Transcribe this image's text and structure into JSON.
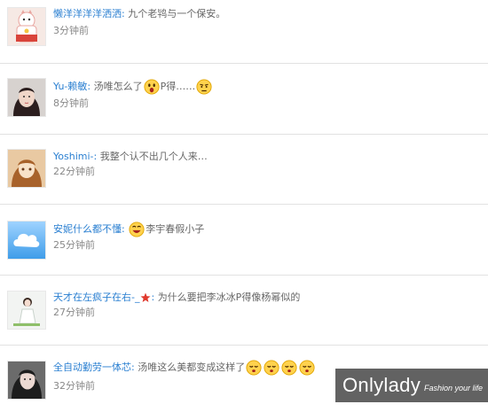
{
  "feed": {
    "items": [
      {
        "user": "懒洋洋洋洋洒洒",
        "text": "九个老鸨与一个保安。",
        "time": "3分钟前",
        "avatar": "lucky-cat-avatar"
      },
      {
        "user": "Yu-赖敏",
        "text": "汤唯怎么了",
        "text2": "P得……",
        "time": "8分钟前",
        "avatar": "girl-portrait-avatar"
      },
      {
        "user": "Yoshimi-",
        "text": "我整个认不出几个人来…",
        "time": "22分钟前",
        "avatar": "anime-girl-avatar"
      },
      {
        "user": "安妮什么都不懂",
        "text": "李宇春假小子",
        "time": "25分钟前",
        "avatar": "cloud-avatar"
      },
      {
        "user": "天才在左疯子在右-_",
        "text": "为什么要把李冰冰P得像杨幂似的",
        "time": "27分钟前",
        "avatar": "doll-figure-avatar"
      },
      {
        "user": "全自动勤劳一体芯",
        "text": "汤唯这么美都变成这样了",
        "time": "32分钟前",
        "avatar": "girl-hair-avatar"
      }
    ]
  },
  "watermark": {
    "logo": "Onlylady",
    "tagline": "Fashion your life"
  }
}
